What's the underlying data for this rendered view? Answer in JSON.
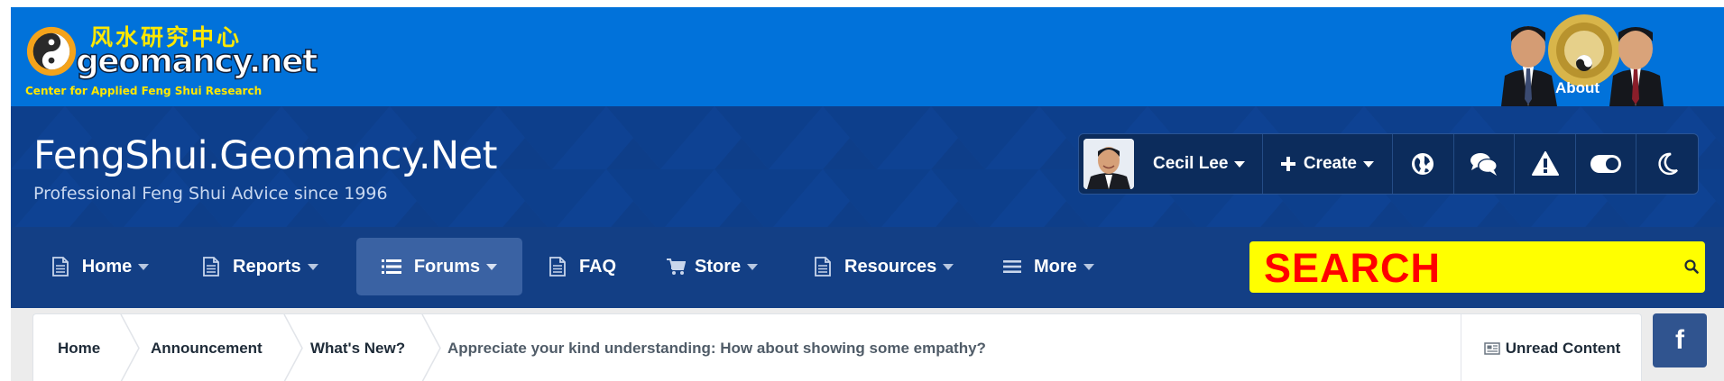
{
  "banner": {
    "logo_cn": "风水研究中心",
    "logo_main": "geomancy.net",
    "logo_tagline": "Center for Applied Feng Shui Research",
    "about_label": "About"
  },
  "header": {
    "title": "FengShui.Geomancy.Net",
    "subtitle": "Professional Feng Shui Advice since 1996"
  },
  "userbar": {
    "username": "Cecil Lee",
    "create_label": "Create",
    "icons": [
      "globe-icon",
      "chat-icon",
      "alert-icon",
      "toggle-icon",
      "moon-icon"
    ]
  },
  "nav": {
    "items": [
      {
        "label": "Home",
        "icon": "document-icon",
        "has_menu": true
      },
      {
        "label": "Reports",
        "icon": "document-icon",
        "has_menu": true
      },
      {
        "label": "Forums",
        "icon": "list-icon",
        "has_menu": true,
        "active": true
      },
      {
        "label": "FAQ",
        "icon": "document-icon",
        "has_menu": false
      },
      {
        "label": "Store",
        "icon": "cart-icon",
        "has_menu": true
      },
      {
        "label": "Resources",
        "icon": "document-icon",
        "has_menu": true
      },
      {
        "label": "More",
        "icon": "hamburger-icon",
        "has_menu": true
      }
    ],
    "search_label": "SEARCH",
    "search_value": ""
  },
  "breadcrumb": {
    "items": [
      "Home",
      "Announcement",
      "What's New?"
    ],
    "current": "Appreciate your kind understanding: How about showing some empathy?",
    "unread_label": "Unread Content"
  },
  "social": {
    "facebook_label": "f"
  },
  "colors": {
    "banner": "#0172da",
    "header": "#0d3f8c",
    "nav": "#133f85",
    "nav_active": "#3a62a3",
    "search_bg": "#ffff00",
    "search_text": "#ff0000",
    "facebook": "#30548f"
  }
}
